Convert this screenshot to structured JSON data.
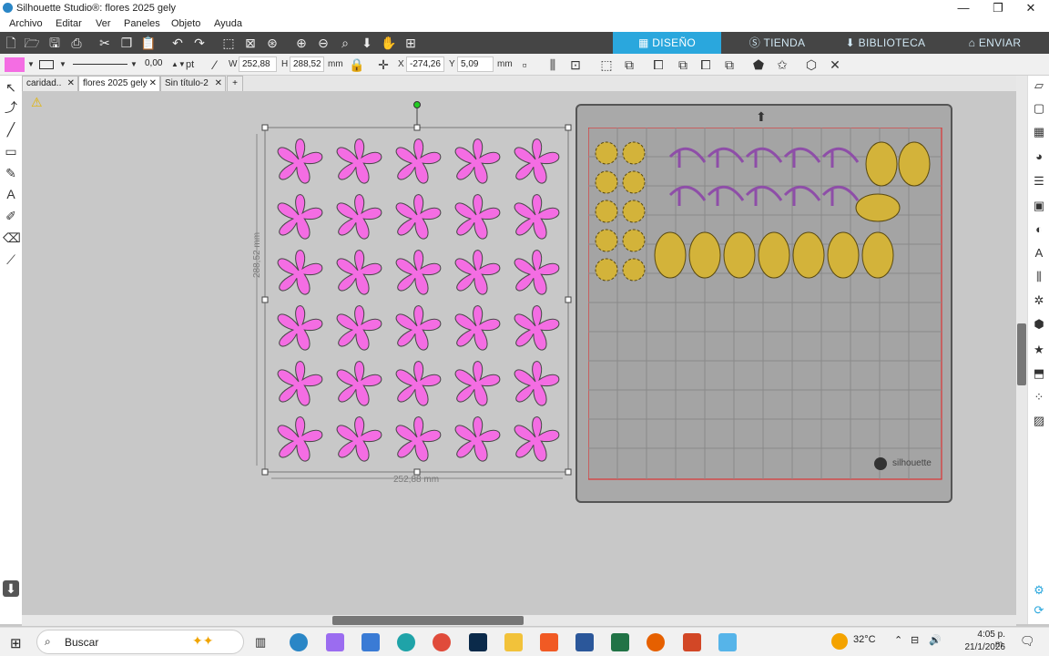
{
  "window": {
    "title": "Silhouette Studio®: flores 2025 gely",
    "minimize": "—",
    "restore": "❐",
    "close": "✕"
  },
  "menu": [
    "Archivo",
    "Editar",
    "Ver",
    "Paneles",
    "Objeto",
    "Ayuda"
  ],
  "nav_tabs": [
    {
      "label": "DISEÑO",
      "active": true
    },
    {
      "label": "TIENDA",
      "active": false
    },
    {
      "label": "BIBLIOTECA",
      "active": false
    },
    {
      "label": "ENVIAR",
      "active": false
    }
  ],
  "line_props": {
    "width_value": "0,00",
    "unit": "pt",
    "fill_color": "#f46de3"
  },
  "size": {
    "w_label": "W",
    "w_value": "252,88",
    "h_label": "H",
    "h_value": "288,52",
    "unit": "mm"
  },
  "position": {
    "x_label": "X",
    "x_value": "-274,26",
    "y_label": "Y",
    "y_value": "5,09",
    "unit": "mm"
  },
  "doc_tabs": [
    {
      "label": "caridad..",
      "active": false
    },
    {
      "label": "flores 2025 gely",
      "active": true
    },
    {
      "label": "Sin título-2",
      "active": false
    }
  ],
  "doc_tab_close": "✕",
  "doc_tab_add": "+",
  "dimensions": {
    "height_label": "288,52 mm",
    "width_label": "252,88 mm"
  },
  "mat": {
    "brand": "silhouette"
  },
  "design": {
    "flower_color": "#f46de3",
    "outline": "#4a4a4a",
    "flower_grid": {
      "cols": 5,
      "rows": 6
    }
  },
  "taskbar": {
    "search": "Buscar",
    "temperature": "32°C",
    "time": "4:05 p. m.",
    "date": "21/1/2026"
  }
}
